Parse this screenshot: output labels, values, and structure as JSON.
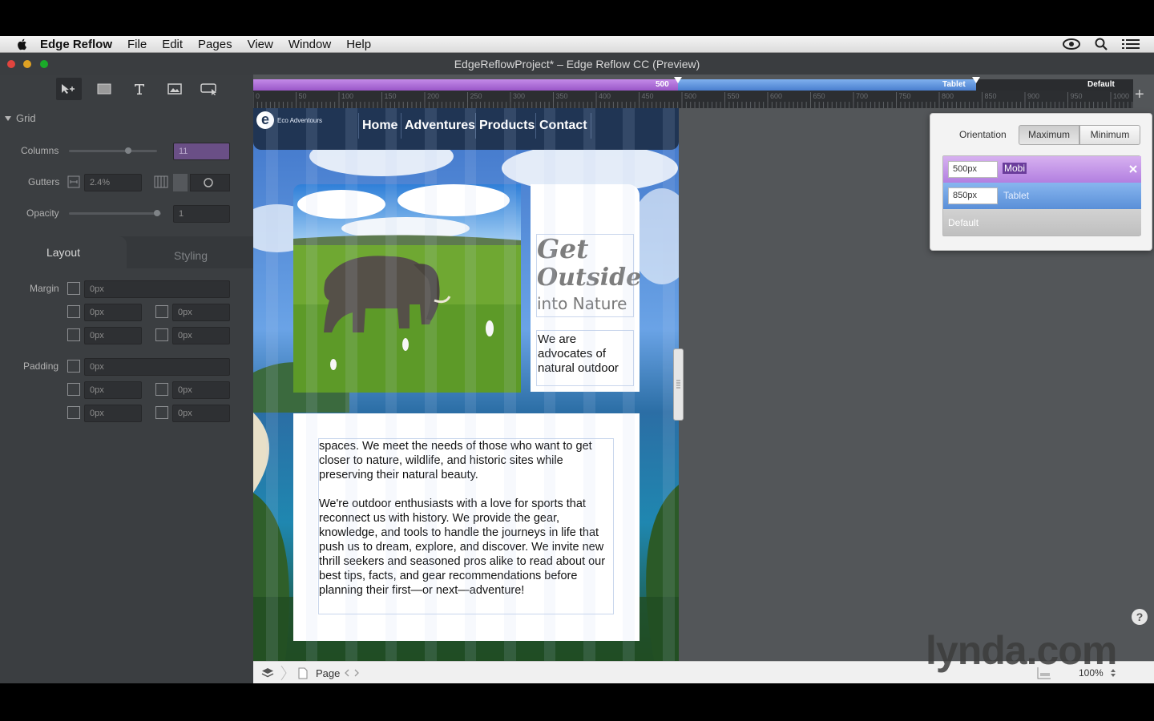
{
  "menubar": {
    "items": [
      {
        "label": "Edge Reflow",
        "bold": true
      },
      {
        "label": "File"
      },
      {
        "label": "Edit"
      },
      {
        "label": "Pages"
      },
      {
        "label": "View"
      },
      {
        "label": "Window"
      },
      {
        "label": "Help"
      }
    ]
  },
  "window": {
    "title": "EdgeReflowProject* – Edge Reflow CC (Preview)"
  },
  "left_panel": {
    "grid_section": "Grid",
    "columns_label": "Columns",
    "columns_value": "11",
    "gutters_label": "Gutters",
    "gutters_value": "2.4%",
    "opacity_label": "Opacity",
    "opacity_value": "1",
    "tabs": {
      "layout": "Layout",
      "styling": "Styling"
    },
    "margin_label": "Margin",
    "padding_label": "Padding",
    "margin_values": [
      "0px",
      "0px",
      "0px",
      "0px",
      "0px"
    ],
    "padding_values": [
      "0px",
      "0px",
      "0px",
      "0px",
      "0px"
    ]
  },
  "media_query_bar": {
    "label_500": "500",
    "label_tablet": "Tablet",
    "label_default": "Default"
  },
  "ruler": {
    "ticks": [
      "0",
      "50",
      "100",
      "150",
      "200",
      "250",
      "300",
      "350",
      "400",
      "450",
      "500",
      "550",
      "600",
      "650",
      "700",
      "750",
      "800",
      "850",
      "900",
      "950",
      "1000"
    ]
  },
  "design_page": {
    "logo_text": "Eco Adventours",
    "nav": [
      "Home",
      "Adventures",
      "Products",
      "Contact"
    ],
    "headline_1": "Get",
    "headline_2": "Outside",
    "headline_3": "into Nature",
    "intro": "We are advocates of natural outdoor",
    "body_p1": "spaces. We meet the needs of those who want to get closer to nature, wildlife, and historic sites while preserving their natural beauty.",
    "body_p2": "We're outdoor enthusiasts with a love for sports that reconnect us with history. We provide the gear, knowledge, and tools to handle the journeys in life that push us to dream, explore, and discover. We invite new thrill seekers and seasoned pros alike to read about our best tips, facts, and gear recommendations before planning their first—or next—adventure!"
  },
  "popover": {
    "orientation_label": "Orientation",
    "maximum": "Maximum",
    "minimum": "Minimum",
    "rows": [
      {
        "px": "500px",
        "name": "Mobi"
      },
      {
        "px": "850px",
        "name": "Tablet"
      }
    ],
    "default_row": "Default"
  },
  "statusbar": {
    "page_label": "Page",
    "zoom": "100%"
  },
  "watermark": "lynda.com",
  "colors": {
    "purple_bp": "#9a57c8",
    "blue_bp": "#4a7fcf",
    "panel_bg": "#3b3e41",
    "canvas_bg": "#535659"
  }
}
